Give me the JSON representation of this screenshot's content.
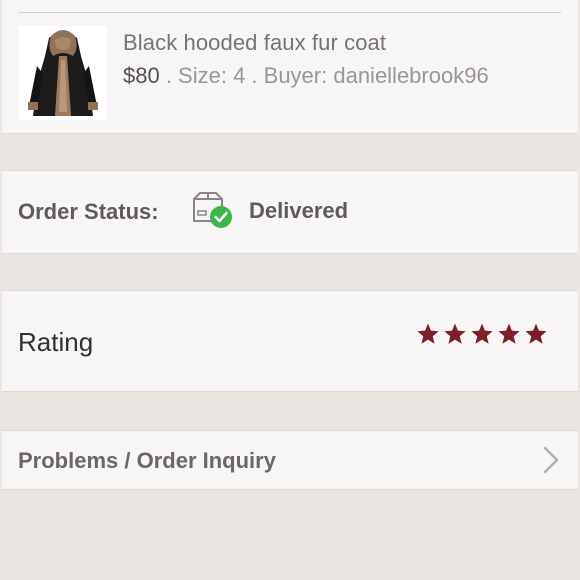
{
  "product": {
    "name": "Black hooded faux fur coat",
    "price": "$80",
    "size_text": " . Size: 4 . Buyer: daniellebrook96",
    "image_icon": "coat-thumbnail"
  },
  "order_status": {
    "label": "Order Status:",
    "value": "Delivered",
    "icon": "delivered-box-icon",
    "check_color": "#3cb54a"
  },
  "rating": {
    "label": "Rating",
    "stars": 5,
    "max_stars": 5,
    "star_color": "#7e1e2b"
  },
  "inquiry": {
    "label": "Problems / Order Inquiry",
    "icon": "chevron-right-icon"
  }
}
